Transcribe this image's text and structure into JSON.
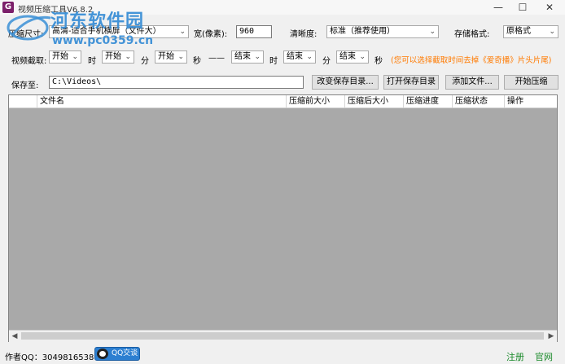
{
  "window": {
    "title": "视频压缩工具V6.8.2",
    "icon_letter": "G",
    "minimize": "—",
    "maximize": "☐",
    "close": "✕"
  },
  "watermark": {
    "line1": "河东软件园",
    "line2": "www.pc0359.cn"
  },
  "row1": {
    "size_label": "压缩尺寸:",
    "size_value": "高清-适合手机横屏（文件大）",
    "width_label": "宽(像素):",
    "width_value": "960",
    "clarity_label": "清晰度:",
    "clarity_value": "标准（推荐使用）",
    "format_label": "存储格式:",
    "format_value": "原格式"
  },
  "row2": {
    "clip_label": "视频截取:",
    "start_h": "开始",
    "hour_unit": "时",
    "start_m": "开始",
    "min_unit": "分",
    "start_s": "开始",
    "sec_unit": "秒",
    "dash": "——",
    "end_h": "结束",
    "end_m": "结束",
    "end_s": "结束",
    "hint": "(您可以选择截取时间去掉《爱奇播》片头片尾)"
  },
  "row3": {
    "save_label": "保存至:",
    "save_path": "C:\\Videos\\",
    "change_dir": "改变保存目录...",
    "open_dir": "打开保存目录",
    "add_file": "添加文件...",
    "start_compress": "开始压缩"
  },
  "table": {
    "columns": [
      "文件名",
      "压缩前大小",
      "压缩后大小",
      "压缩进度",
      "压缩状态",
      "操作"
    ],
    "rows": []
  },
  "footer": {
    "author": "作者QQ：3049816538",
    "qq_button": "QQ交谈",
    "register": "注册",
    "official_site": "官网"
  },
  "colors": {
    "hint": "#ff7a00",
    "link": "#1a8a2a",
    "list_bg": "#a9a9a9",
    "watermark": "#3a8fd6"
  }
}
